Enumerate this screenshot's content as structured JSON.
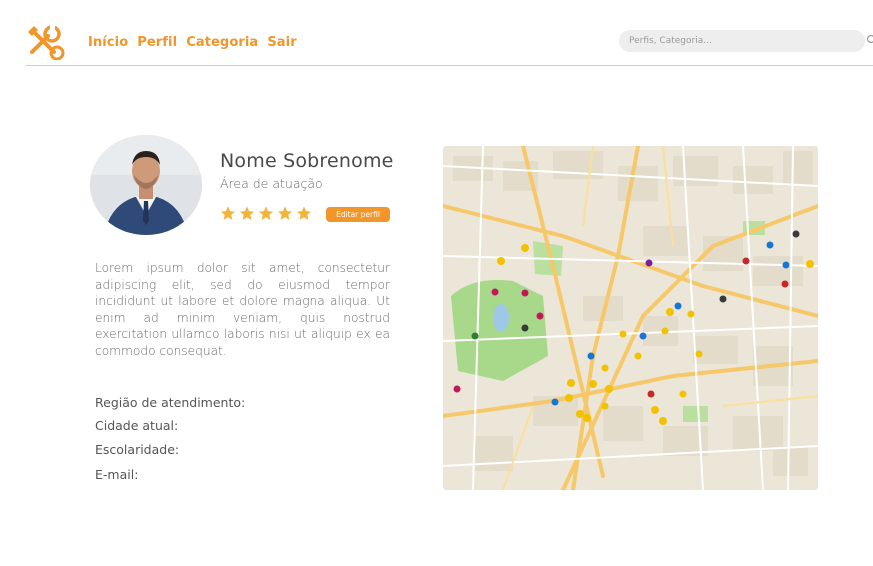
{
  "header": {
    "nav": [
      "Início",
      "Perfil",
      "Categoria",
      "Sair"
    ],
    "search_placeholder": "Perfis, Categoria..."
  },
  "profile": {
    "name": "Nome Sobrenome",
    "area": "Área de atuação",
    "rating": 5,
    "edit_label": "Editar perfil",
    "bio": "Lorem ipsum dolor sit amet, consectetur adipiscing elit, sed do eiusmod tempor incididunt ut labore et dolore magna aliqua. Ut enim ad minim veniam, quis nostrud exercitation ullamco laboris nisi ut aliquip ex ea commodo consequat."
  },
  "info": {
    "region": "Região de atendimento:",
    "city": "Cidade atual:",
    "education": "Escolaridade:",
    "email": "E-mail:"
  },
  "colors": {
    "accent": "#f0962a",
    "star": "#f3b43a"
  },
  "icons": {
    "logo": "tools-logo-icon",
    "search": "search-icon",
    "star": "star-icon"
  }
}
